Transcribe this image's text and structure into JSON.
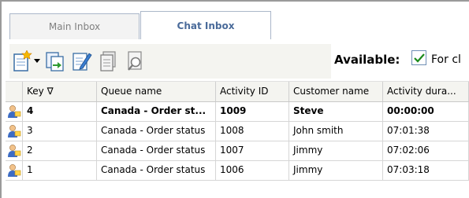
{
  "tabs": [
    {
      "label": "Main Inbox"
    },
    {
      "label": "Chat Inbox"
    }
  ],
  "toolbar": {
    "icons": [
      "new-document-icon",
      "dropdown-arrow-icon",
      "transfer-icon",
      "edit-icon",
      "document-icon",
      "search-document-icon"
    ],
    "available_label": "Available:",
    "available_checked": true,
    "available_option": "For cl"
  },
  "grid": {
    "columns": [
      "Key ∇",
      "Queue name",
      "Activity ID",
      "Customer name",
      "Activity dura..."
    ],
    "rows": [
      {
        "key": "4",
        "queue": "Canada  - Order st...",
        "activity_id": "1009",
        "customer": "Steve",
        "duration": "00:00:00",
        "bold": true
      },
      {
        "key": "3",
        "queue": "Canada  - Order status",
        "activity_id": "1008",
        "customer": "John smith",
        "duration": "07:01:38",
        "bold": false
      },
      {
        "key": "2",
        "queue": "Canada  - Order status",
        "activity_id": "1007",
        "customer": "Jimmy",
        "duration": "07:02:06",
        "bold": false
      },
      {
        "key": "1",
        "queue": "Canada  - Order status",
        "activity_id": "1006",
        "customer": "Jimmy",
        "duration": "07:03:18",
        "bold": false
      }
    ]
  },
  "colors": {
    "active_tab_text": "#4a6b9a",
    "inactive_tab_text": "#808080",
    "checkbox_border": "#6f8fb5",
    "check_mark": "#1a8a1a"
  }
}
